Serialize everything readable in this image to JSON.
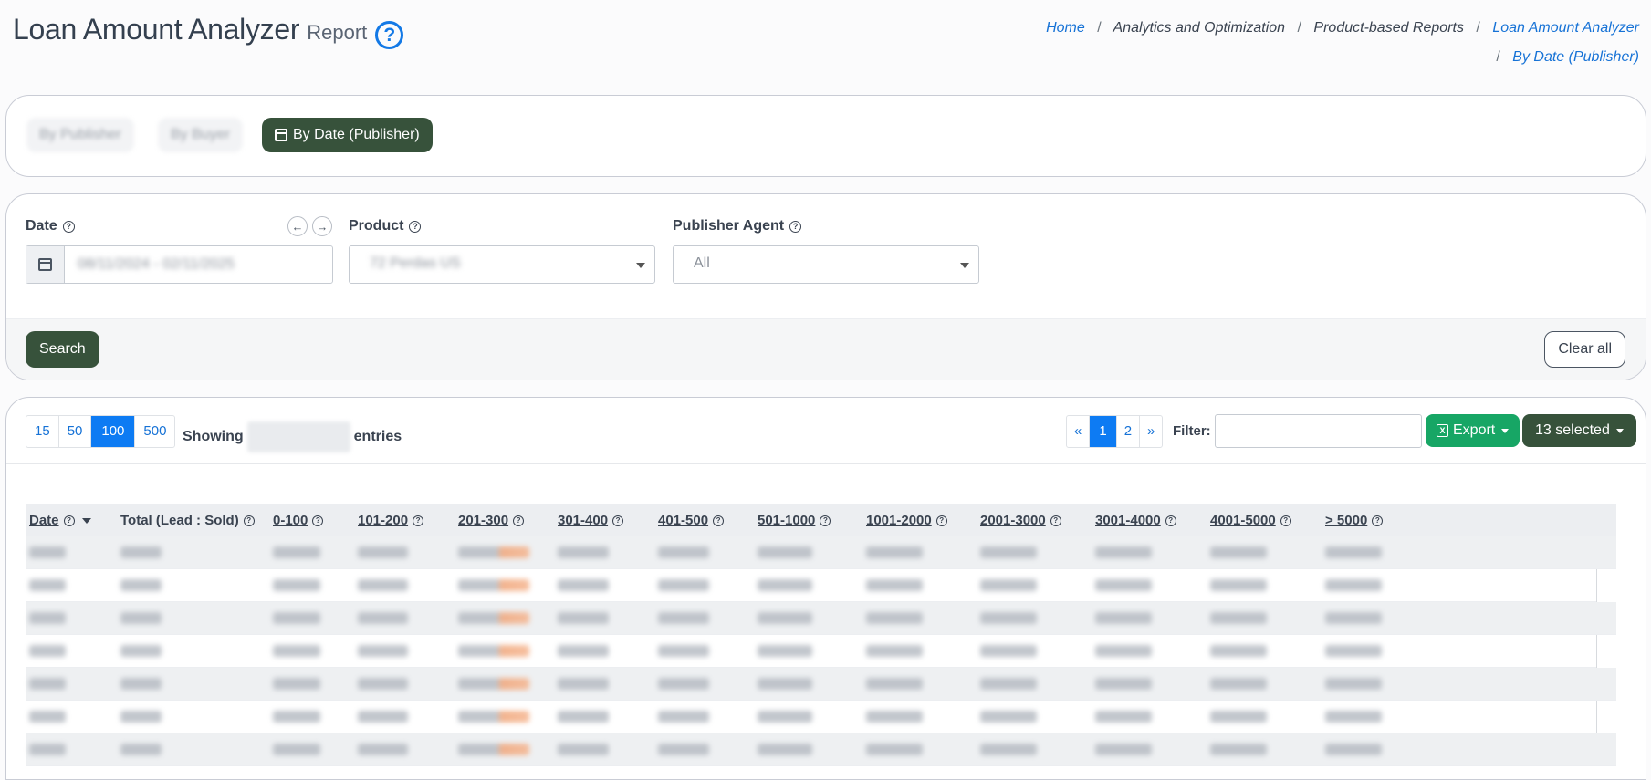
{
  "header": {
    "title": "Loan Amount Analyzer",
    "subtitle": "Report",
    "help_icon": "?",
    "breadcrumb": {
      "home": "Home",
      "analytics": "Analytics and Optimization",
      "product_reports": "Product-based Reports",
      "analyzer": "Loan Amount Analyzer",
      "current": "By Date (Publisher)",
      "separator": "/"
    }
  },
  "tabs": {
    "by_publisher": "By Publisher",
    "by_buyer": "By Buyer",
    "by_date_publisher": "By Date (Publisher)"
  },
  "filters": {
    "date_label": "Date",
    "date_value": "08/11/2024 - 02/11/2025",
    "prev_arrow": "←",
    "next_arrow": "→",
    "product_label": "Product",
    "product_value": "72 Perdas US",
    "publisher_label": "Publisher Agent",
    "publisher_value": "All",
    "search": "Search",
    "clear": "Clear all",
    "help": "?"
  },
  "table_controls": {
    "page_sizes": [
      "15",
      "50",
      "100",
      "500"
    ],
    "active_page_size": "100",
    "showing_prefix": "Showing",
    "showing_suffix": "entries",
    "pager": {
      "prev": "«",
      "pages": [
        "1",
        "2"
      ],
      "active": "1",
      "next": "»"
    },
    "filter_label": "Filter:",
    "export": "Export",
    "export_icon": "X",
    "selected": "13 selected"
  },
  "table": {
    "columns": [
      {
        "label": "Date",
        "underline": true,
        "help": true,
        "sort": "desc"
      },
      {
        "label": "Total (Lead : Sold)",
        "underline": false,
        "help": true
      },
      {
        "label": "0-100",
        "underline": true,
        "help": true
      },
      {
        "label": "101-200",
        "underline": true,
        "help": true
      },
      {
        "label": "201-300",
        "underline": true,
        "help": true
      },
      {
        "label": "301-400",
        "underline": true,
        "help": true
      },
      {
        "label": "401-500",
        "underline": true,
        "help": true
      },
      {
        "label": "501-1000",
        "underline": true,
        "help": true
      },
      {
        "label": "1001-2000",
        "underline": true,
        "help": true
      },
      {
        "label": "2001-3000",
        "underline": true,
        "help": true
      },
      {
        "label": "3001-4000",
        "underline": true,
        "help": true
      },
      {
        "label": "4001-5000",
        "underline": true,
        "help": true
      },
      {
        "label": "> 5000",
        "underline": true,
        "help": true
      }
    ],
    "row_count": 7,
    "highlight_column": 4,
    "highlight_color": "#f5b48e"
  },
  "colors": {
    "primary_dark_green": "#37523b",
    "link_blue": "#1672d6",
    "active_blue": "#0d7bf3",
    "export_green": "#17a665"
  }
}
